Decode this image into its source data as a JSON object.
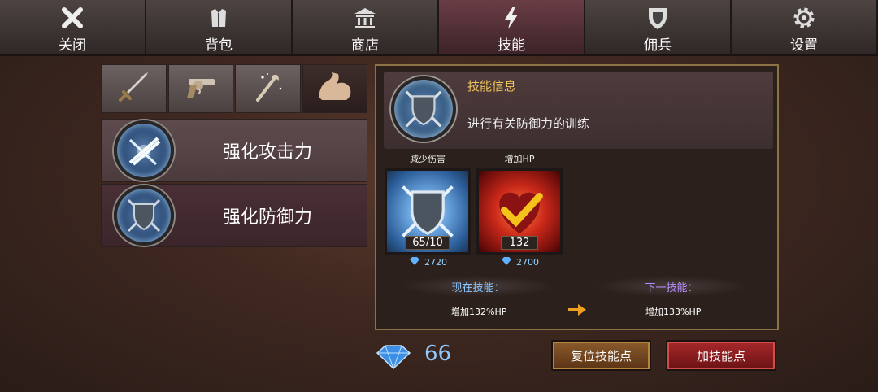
{
  "nav": {
    "tabs": [
      {
        "label": "关闭",
        "icon": "close-icon"
      },
      {
        "label": "背包",
        "icon": "armor-icon"
      },
      {
        "label": "商店",
        "icon": "shop-icon"
      },
      {
        "label": "技能",
        "icon": "lightning-icon"
      },
      {
        "label": "佣兵",
        "icon": "shield-icon"
      },
      {
        "label": "设置",
        "icon": "gear-icon"
      }
    ],
    "active_tab": "技能"
  },
  "categories": [
    {
      "icon": "sword-icon"
    },
    {
      "icon": "revolver-icon"
    },
    {
      "icon": "magic-staff-icon"
    },
    {
      "icon": "flexed-arm-icon"
    }
  ],
  "skills": [
    {
      "name": "强化攻击力",
      "icon": "crossed-blades-icon"
    },
    {
      "name": "强化防御力",
      "icon": "shield-swords-icon"
    }
  ],
  "info": {
    "title": "技能信息",
    "description": "进行有关防御力的训练"
  },
  "stats": [
    {
      "label": "减少伤害",
      "value": "65/10",
      "cost": "2720",
      "icon": "shield-swords-icon"
    },
    {
      "label": "增加HP",
      "value": "132",
      "cost": "2700",
      "icon": "heart-check-icon"
    }
  ],
  "current": {
    "label": "现在技能：",
    "value": "增加132%HP"
  },
  "next": {
    "label": "下一技能：",
    "value": "增加133%HP"
  },
  "gems": "66",
  "buttons": {
    "reset": "复位技能点",
    "add": "加技能点"
  },
  "colors": {
    "gold_border": "#8c7346",
    "title_gold": "#f0c45a",
    "gem_blue": "#8ec8ff",
    "next_purple": "#b78cff"
  }
}
